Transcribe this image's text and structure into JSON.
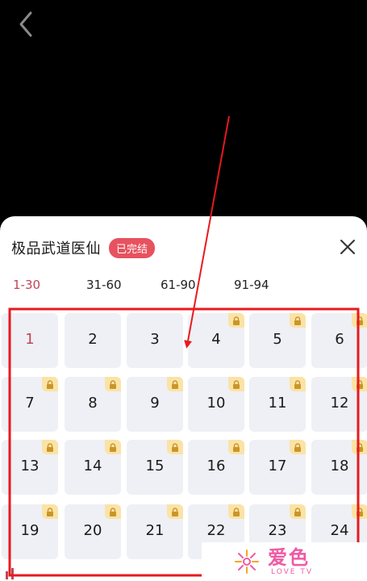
{
  "drama": {
    "title": "极品武道医仙",
    "status": "已完结"
  },
  "tabs": [
    {
      "label": "1-30",
      "active": true
    },
    {
      "label": "31-60",
      "active": false
    },
    {
      "label": "61-90",
      "active": false
    },
    {
      "label": "91-94",
      "active": false
    }
  ],
  "episodes": [
    {
      "num": "1",
      "current": true,
      "locked": false
    },
    {
      "num": "2",
      "current": false,
      "locked": false
    },
    {
      "num": "3",
      "current": false,
      "locked": false
    },
    {
      "num": "4",
      "current": false,
      "locked": true
    },
    {
      "num": "5",
      "current": false,
      "locked": true
    },
    {
      "num": "6",
      "current": false,
      "locked": true
    },
    {
      "num": "7",
      "current": false,
      "locked": true
    },
    {
      "num": "8",
      "current": false,
      "locked": true
    },
    {
      "num": "9",
      "current": false,
      "locked": true
    },
    {
      "num": "10",
      "current": false,
      "locked": true
    },
    {
      "num": "11",
      "current": false,
      "locked": true
    },
    {
      "num": "12",
      "current": false,
      "locked": true
    },
    {
      "num": "13",
      "current": false,
      "locked": true
    },
    {
      "num": "14",
      "current": false,
      "locked": true
    },
    {
      "num": "15",
      "current": false,
      "locked": true
    },
    {
      "num": "16",
      "current": false,
      "locked": true
    },
    {
      "num": "17",
      "current": false,
      "locked": true
    },
    {
      "num": "18",
      "current": false,
      "locked": true
    },
    {
      "num": "19",
      "current": false,
      "locked": true
    },
    {
      "num": "20",
      "current": false,
      "locked": true
    },
    {
      "num": "21",
      "current": false,
      "locked": true
    },
    {
      "num": "22",
      "current": false,
      "locked": true
    },
    {
      "num": "23",
      "current": false,
      "locked": true
    },
    {
      "num": "24",
      "current": false,
      "locked": true
    }
  ],
  "watermark": {
    "cn": "爱色",
    "en": "LOVE TV"
  },
  "colors": {
    "accent": "#c24456",
    "badge": "#e7525f",
    "annotation_red": "#e8191d",
    "lock_bg": "#fbe3a6",
    "cell_bg": "#eef0f5",
    "watermark_pink": "#ef5aa4"
  },
  "icons": {
    "back": "chevron-left-icon",
    "close": "close-icon",
    "lock": "lock-icon",
    "playing": "playing-bars-icon"
  }
}
